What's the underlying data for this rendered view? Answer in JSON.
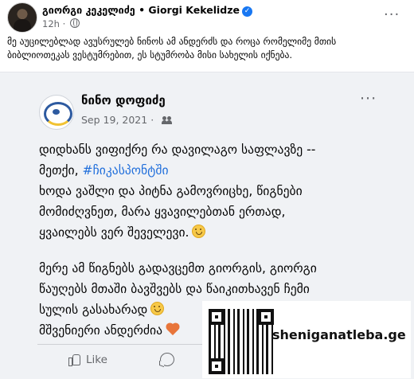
{
  "header": {
    "author": "გიორგი კეკელიძე • Giorgi Kekelidze",
    "time": "12h",
    "more": "···"
  },
  "caption": {
    "line1": "მე აუცილებლად ავუსრულებ ნინოს ამ ანდერძს და როცა რომელიმე მთის",
    "line2": "ბიბლიოთეკას ვესტუმრებით, ეს სტუმრობა მისი სახელის იქნება."
  },
  "shared_post": {
    "author": "ნინო დოფიძე",
    "date": "Sep 19, 2021",
    "separator": "·",
    "more": "···",
    "lines": [
      "დიდხანს ვიფიქრე რა დავილაგო საფლავზე --",
      "მეთქი, ",
      " ხოდა ვაშლი და პიტნა გამოვრიცხე, წიგნები",
      "მომიძღვნეთ, მარა ყვავილებთან ერთად,",
      "ყვაილებს ვერ შეველევი.",
      "მერე ამ წიგნებს გადავცემთ გიორგის, გიორგი",
      "წაუღებს მთაში ბავშვებს და წაიკითხავენ ჩემი",
      "სულის გასახარად",
      "მშვენიერი ანდერძია"
    ],
    "hashtag": "#ჩიკასპონტში"
  },
  "actions": {
    "like": "Like"
  },
  "watermark": {
    "text": "sheniganatleba.ge"
  }
}
